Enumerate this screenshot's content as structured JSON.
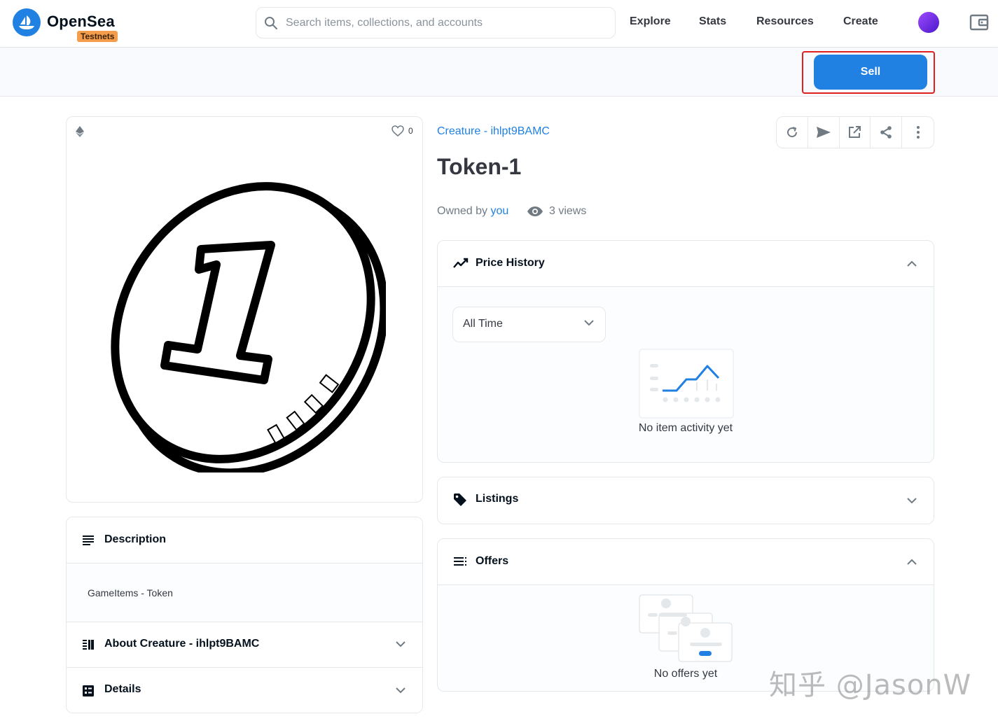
{
  "header": {
    "brand": "OpenSea",
    "badge": "Testnets",
    "search_placeholder": "Search items, collections, and accounts",
    "nav": [
      "Explore",
      "Stats",
      "Resources",
      "Create"
    ]
  },
  "sell_bar": {
    "sell_label": "Sell"
  },
  "asset": {
    "favorites_count": "0",
    "collection_name": "Creature - ihlpt9BAMC",
    "title": "Token-1",
    "owned_by_prefix": "Owned by",
    "owner": "you",
    "views": "3 views"
  },
  "left_panels": {
    "description_title": "Description",
    "description_text": "GameItems - Token",
    "about_title": "About Creature - ihlpt9BAMC",
    "details_title": "Details"
  },
  "price_history": {
    "title": "Price History",
    "range_selected": "All Time",
    "empty_text": "No item activity yet"
  },
  "listings": {
    "title": "Listings"
  },
  "offers": {
    "title": "Offers",
    "empty_text": "No offers yet"
  },
  "watermark": "知乎 @JasonW",
  "colors": {
    "accent": "#2081e2",
    "highlight_box": "#e02020",
    "badge": "#f49e4c"
  }
}
